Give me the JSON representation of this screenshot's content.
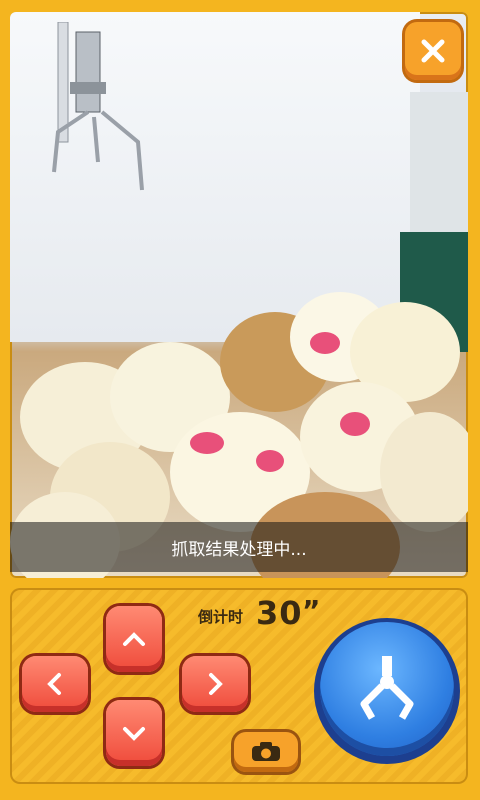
{
  "status": {
    "text": "抓取结果处理中..."
  },
  "timer": {
    "label": "倒计时",
    "value": "30",
    "unit": "”"
  },
  "icons": {
    "close": "close-icon",
    "up": "chevron-up-icon",
    "down": "chevron-down-icon",
    "left": "chevron-left-icon",
    "right": "chevron-right-icon",
    "grab": "claw-icon",
    "camera": "camera-icon"
  },
  "colors": {
    "frame": "#f4b51f",
    "dpad": "#ef4a3a",
    "grab": "#2f7fe2",
    "close": "#f7a22a"
  }
}
